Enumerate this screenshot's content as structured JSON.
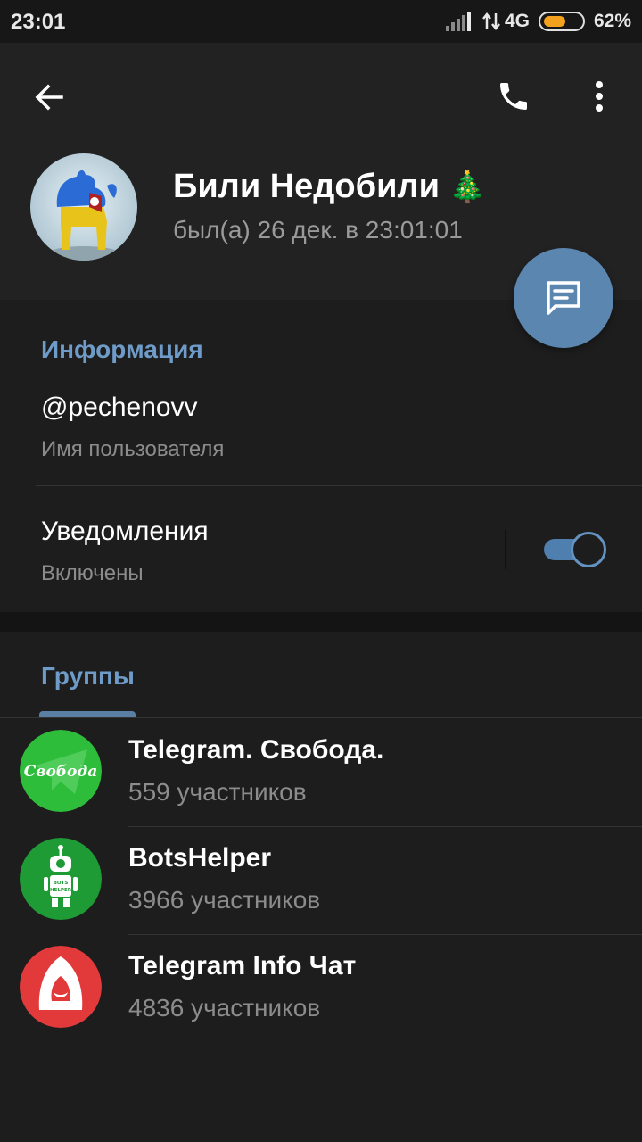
{
  "status_bar": {
    "time": "23:01",
    "network": "4G",
    "battery_percent": "62%",
    "battery_level": 0.62,
    "battery_color": "#f4a21d"
  },
  "header": {
    "back_icon": "arrow-left-icon",
    "call_icon": "phone-icon",
    "more_icon": "more-vertical-icon"
  },
  "profile": {
    "name": "Били Недобили",
    "name_emoji": "🎄",
    "status": "был(а) 26 дек. в 23:01:01",
    "fab_icon": "message-icon"
  },
  "info": {
    "title": "Информация",
    "username": "@pechenovv",
    "username_label": "Имя пользователя",
    "notifications_label": "Уведомления",
    "notifications_state": "Включены",
    "notifications_on": true
  },
  "groups": {
    "title": "Группы",
    "items": [
      {
        "name": "Telegram. Свобода.",
        "count": "559 участников",
        "avatar_text": "Свобода",
        "color": "#2dbd3a"
      },
      {
        "name": "BotsHelper",
        "count": "3966 участников",
        "avatar_text": "BOTS HELPER",
        "color": "#1e9b34"
      },
      {
        "name": "Telegram Info Чат",
        "count": "4836 участников",
        "avatar_text": "",
        "color": "#e23a3a"
      }
    ]
  },
  "colors": {
    "accent": "#6f9bc8",
    "fab": "#5b86b0",
    "background": "#1d1d1d",
    "header": "#222222"
  }
}
